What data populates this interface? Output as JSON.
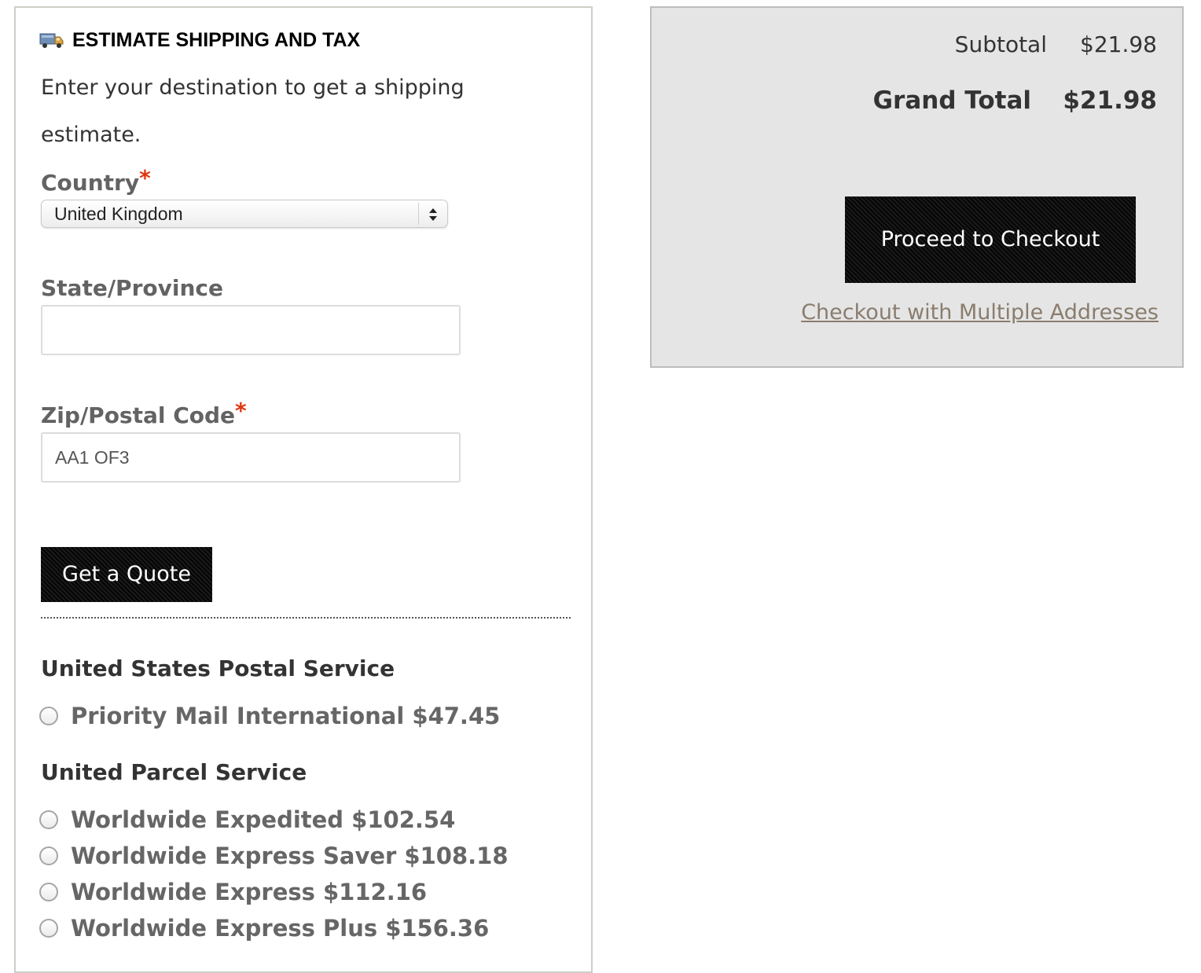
{
  "shipping": {
    "title": "ESTIMATE SHIPPING AND TAX",
    "intro": "Enter your destination to get a shipping estimate.",
    "country": {
      "label": "Country",
      "required_mark": "*",
      "selected": "United Kingdom"
    },
    "state": {
      "label": "State/Province",
      "value": ""
    },
    "zip": {
      "label": "Zip/Postal Code",
      "required_mark": "*",
      "value": "AA1 OF3"
    },
    "quote_button": "Get a Quote",
    "carriers": [
      {
        "name": "United States Postal Service",
        "options": [
          {
            "label": "Priority Mail International $47.45"
          }
        ]
      },
      {
        "name": "United Parcel Service",
        "options": [
          {
            "label": "Worldwide Expedited $102.54"
          },
          {
            "label": "Worldwide Express Saver $108.18"
          },
          {
            "label": "Worldwide Express $112.16"
          },
          {
            "label": "Worldwide Express Plus $156.36"
          }
        ]
      }
    ]
  },
  "totals": {
    "subtotal_label": "Subtotal",
    "subtotal_value": "$21.98",
    "grand_total_label": "Grand Total",
    "grand_total_value": "$21.98",
    "checkout_button": "Proceed to Checkout",
    "multi_address_link": "Checkout with Multiple Addresses"
  },
  "icons": {
    "truck": "truck-icon",
    "select_arrows": "select-arrows-icon"
  },
  "colors": {
    "required": "#e0350f",
    "button_bg": "#111111",
    "totals_bg": "#e5e5e5",
    "link": "#8a7d6e"
  }
}
